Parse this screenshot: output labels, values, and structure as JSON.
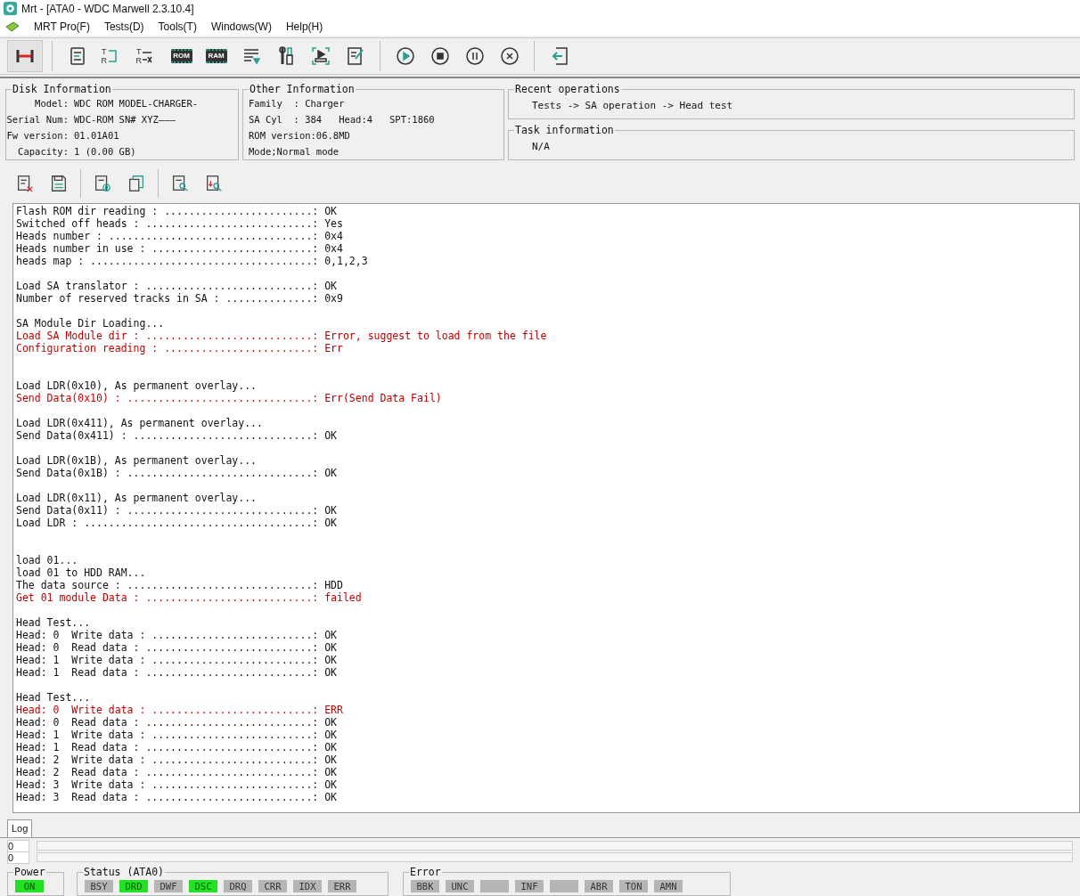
{
  "window": {
    "title": "Mrt - [ATA0 - WDC Marwell 2.3.10.4]"
  },
  "menu": [
    "MRT Pro(F)",
    "Tests(D)",
    "Tools(T)",
    "Windows(W)",
    "Help(H)"
  ],
  "toolbar": [
    {
      "kind": "connect",
      "selected": true
    },
    {
      "kind": "sep"
    },
    {
      "kind": "doc",
      "selected": false
    },
    {
      "kind": "tr",
      "top": "T",
      "bottom": "R",
      "selected": false
    },
    {
      "kind": "trx",
      "top": "T",
      "bottom": "R",
      "selected": false
    },
    {
      "kind": "chip",
      "label": "ROM",
      "selected": false
    },
    {
      "kind": "chip",
      "label": "RAM",
      "selected": false
    },
    {
      "kind": "list",
      "selected": false
    },
    {
      "kind": "tools",
      "selected": false
    },
    {
      "kind": "screen",
      "selected": false
    },
    {
      "kind": "edit",
      "selected": false
    },
    {
      "kind": "sep"
    },
    {
      "kind": "play",
      "selected": false
    },
    {
      "kind": "stop",
      "selected": false
    },
    {
      "kind": "pause",
      "selected": false
    },
    {
      "kind": "cancel",
      "selected": false
    },
    {
      "kind": "sep"
    },
    {
      "kind": "exit",
      "selected": false
    }
  ],
  "disk_information": {
    "title": "Disk Information",
    "rows": [
      {
        "label": "Model:",
        "value": "WDC ROM MODEL-CHARGER-"
      },
      {
        "label": "Serial Num:",
        "value": "WDC-ROM SN# XYZ———"
      },
      {
        "label": "Fw version:",
        "value": "01.01A01"
      },
      {
        "label": "Capacity:",
        "value": "1 (0.00 GB)"
      }
    ]
  },
  "other_information": {
    "title": "Other Information",
    "lines": [
      "Family  : Charger",
      "SA Cyl  : 384   Head:4   SPT:1860",
      "ROM version:06.8MD",
      "Mode;Normal mode"
    ]
  },
  "recent_operations": {
    "title": "Recent operations",
    "text": "Tests -> SA operation -> Head test"
  },
  "task_information": {
    "title": "Task information",
    "text": "N/A"
  },
  "log_toolbar": [
    {
      "kind": "clear"
    },
    {
      "kind": "save"
    },
    {
      "kind": "sep"
    },
    {
      "kind": "pause-log"
    },
    {
      "kind": "copy"
    },
    {
      "kind": "sep"
    },
    {
      "kind": "find"
    },
    {
      "kind": "find-down"
    }
  ],
  "log": [
    {
      "kind": "line",
      "text": "Flash ROM dir reading : ........................: OK",
      "error": false
    },
    {
      "kind": "line",
      "text": "Switched off heads : ...........................: Yes",
      "error": false
    },
    {
      "kind": "line",
      "text": "Heads number : .................................: 0x4",
      "error": false
    },
    {
      "kind": "line",
      "text": "Heads number in use : ..........................: 0x4",
      "error": false
    },
    {
      "kind": "line",
      "text": "heads map : ....................................: 0,1,2,3",
      "error": false
    },
    {
      "kind": "blank"
    },
    {
      "kind": "line",
      "text": "Load SA translator : ...........................: OK",
      "error": false
    },
    {
      "kind": "line",
      "text": "Number of reserved tracks in SA : ..............: 0x9",
      "error": false
    },
    {
      "kind": "blank"
    },
    {
      "kind": "line",
      "text": "SA Module Dir Loading...",
      "error": false
    },
    {
      "kind": "line",
      "text": "Load SA Module dir : ...........................: Error, suggest to load from the file",
      "error": true
    },
    {
      "kind": "line",
      "text": "Configuration reading : ........................: Err",
      "error": true
    },
    {
      "kind": "blank"
    },
    {
      "kind": "blank"
    },
    {
      "kind": "line",
      "text": "Load LDR(0x10), As permanent overlay...",
      "error": false
    },
    {
      "kind": "line",
      "text": "Send Data(0x10) : ..............................: Err(Send Data Fail)",
      "error": true
    },
    {
      "kind": "blank"
    },
    {
      "kind": "line",
      "text": "Load LDR(0x411), As permanent overlay...",
      "error": false
    },
    {
      "kind": "line",
      "text": "Send Data(0x411) : .............................: OK",
      "error": false
    },
    {
      "kind": "blank"
    },
    {
      "kind": "line",
      "text": "Load LDR(0x1B), As permanent overlay...",
      "error": false
    },
    {
      "kind": "line",
      "text": "Send Data(0x1B) : ..............................: OK",
      "error": false
    },
    {
      "kind": "blank"
    },
    {
      "kind": "line",
      "text": "Load LDR(0x11), As permanent overlay...",
      "error": false
    },
    {
      "kind": "line",
      "text": "Send Data(0x11) : ..............................: OK",
      "error": false
    },
    {
      "kind": "line",
      "text": "Load LDR : .....................................: OK",
      "error": false
    },
    {
      "kind": "blank"
    },
    {
      "kind": "blank"
    },
    {
      "kind": "line",
      "text": "load 01...",
      "error": false
    },
    {
      "kind": "line",
      "text": "load 01 to HDD RAM...",
      "error": false
    },
    {
      "kind": "line",
      "text": "The data source : ..............................: HDD",
      "error": false
    },
    {
      "kind": "line",
      "text": "Get 01 module Data : ...........................: failed",
      "error": true
    },
    {
      "kind": "blank"
    },
    {
      "kind": "line",
      "text": "Head Test...",
      "error": false
    },
    {
      "kind": "line",
      "text": "Head: 0  Write data : ..........................: OK",
      "error": false
    },
    {
      "kind": "line",
      "text": "Head: 0  Read data : ...........................: OK",
      "error": false
    },
    {
      "kind": "line",
      "text": "Head: 1  Write data : ..........................: OK",
      "error": false
    },
    {
      "kind": "line",
      "text": "Head: 1  Read data : ...........................: OK",
      "error": false
    },
    {
      "kind": "blank"
    },
    {
      "kind": "line",
      "text": "Head Test...",
      "error": false
    },
    {
      "kind": "line",
      "text": "Head: 0  Write data : ..........................: ERR",
      "error": true
    },
    {
      "kind": "line",
      "text": "Head: 0  Read data : ...........................: OK",
      "error": false
    },
    {
      "kind": "line",
      "text": "Head: 1  Write data : ..........................: OK",
      "error": false
    },
    {
      "kind": "line",
      "text": "Head: 1  Read data : ...........................: OK",
      "error": false
    },
    {
      "kind": "line",
      "text": "Head: 2  Write data : ..........................: OK",
      "error": false
    },
    {
      "kind": "line",
      "text": "Head: 2  Read data : ...........................: OK",
      "error": false
    },
    {
      "kind": "line",
      "text": "Head: 3  Write data : ..........................: OK",
      "error": false
    },
    {
      "kind": "line",
      "text": "Head: 3  Read data : ...........................: OK",
      "error": false
    }
  ],
  "tabs": [
    {
      "label": "Log",
      "selected": true
    }
  ],
  "counters": [
    "0",
    "0"
  ],
  "power": {
    "title": "Power",
    "indicators": [
      {
        "label": "ON",
        "on": true
      }
    ]
  },
  "status": {
    "title": "Status (ATA0)",
    "indicators": [
      {
        "label": "BSY",
        "on": false
      },
      {
        "label": "DRD",
        "on": true
      },
      {
        "label": "DWF",
        "on": false
      },
      {
        "label": "DSC",
        "on": true
      },
      {
        "label": "DRQ",
        "on": false
      },
      {
        "label": "CRR",
        "on": false
      },
      {
        "label": "IDX",
        "on": false
      },
      {
        "label": "ERR",
        "on": false
      }
    ]
  },
  "error": {
    "title": "Error",
    "indicators": [
      {
        "label": "BBK",
        "on": false
      },
      {
        "label": "UNC",
        "on": false
      },
      {
        "on": false
      },
      {
        "label": "INF",
        "on": false
      },
      {
        "on": false
      },
      {
        "label": "ABR",
        "on": false
      },
      {
        "label": "TON",
        "on": false
      },
      {
        "label": "AMN",
        "on": false
      }
    ]
  }
}
